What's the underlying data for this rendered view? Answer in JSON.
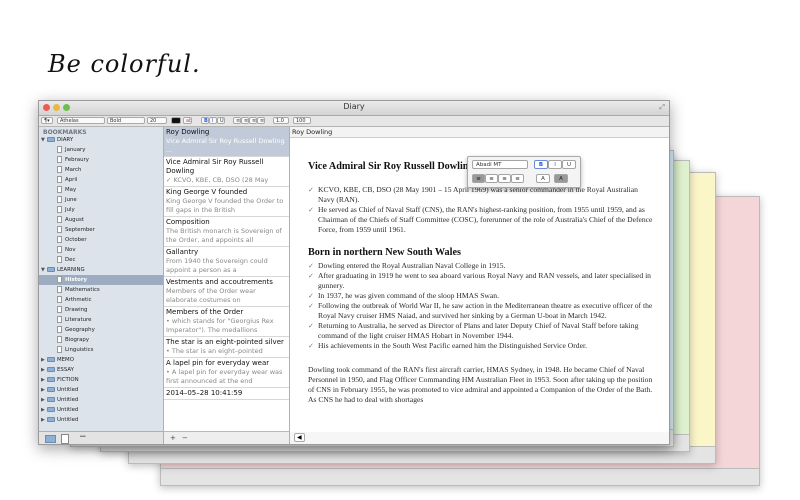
{
  "headline": "Be colorful.",
  "window": {
    "title": "Diary"
  },
  "toolbar": {
    "font": "Athelas",
    "weight": "Bold",
    "size": "20",
    "bold": "B",
    "italic": "I",
    "underline": "U",
    "line_spacing": "1.0",
    "zoom": "100"
  },
  "sidebar": {
    "header": "BOOKMARKS",
    "items": [
      {
        "label": "DIARY",
        "type": "folder",
        "level": 0,
        "expanded": true
      },
      {
        "label": "January",
        "type": "doc",
        "level": 1
      },
      {
        "label": "Febraury",
        "type": "doc",
        "level": 1
      },
      {
        "label": "March",
        "type": "doc",
        "level": 1
      },
      {
        "label": "April",
        "type": "doc",
        "level": 1
      },
      {
        "label": "May",
        "type": "doc",
        "level": 1
      },
      {
        "label": "June",
        "type": "doc",
        "level": 1
      },
      {
        "label": "July",
        "type": "doc",
        "level": 1
      },
      {
        "label": "August",
        "type": "doc",
        "level": 1
      },
      {
        "label": "September",
        "type": "doc",
        "level": 1
      },
      {
        "label": "October",
        "type": "doc",
        "level": 1
      },
      {
        "label": "Nov",
        "type": "doc",
        "level": 1
      },
      {
        "label": "Dec",
        "type": "doc",
        "level": 1
      },
      {
        "label": "LEARNING",
        "type": "folder",
        "level": 0,
        "expanded": true
      },
      {
        "label": "History",
        "type": "doc",
        "level": 1,
        "selected": true
      },
      {
        "label": "Mathematics",
        "type": "doc",
        "level": 1
      },
      {
        "label": "Arthmetic",
        "type": "doc",
        "level": 1
      },
      {
        "label": "Drawing",
        "type": "doc",
        "level": 1
      },
      {
        "label": "Literature",
        "type": "doc",
        "level": 1
      },
      {
        "label": "Geography",
        "type": "doc",
        "level": 1
      },
      {
        "label": "Biograpy",
        "type": "doc",
        "level": 1
      },
      {
        "label": "Linguistics",
        "type": "doc",
        "level": 1
      },
      {
        "label": "MEMO",
        "type": "folder",
        "level": 0
      },
      {
        "label": "ESSAY",
        "type": "folder",
        "level": 0
      },
      {
        "label": "FICTION",
        "type": "folder",
        "level": 0
      },
      {
        "label": "Untitled",
        "type": "folder",
        "level": 0
      },
      {
        "label": "Untitled",
        "type": "folder",
        "level": 0
      },
      {
        "label": "Untitled",
        "type": "folder",
        "level": 0
      },
      {
        "label": "Untitled",
        "type": "folder",
        "level": 0
      }
    ],
    "bottom_minus": "−"
  },
  "notes": [
    {
      "title": "Roy Dowling",
      "snippet": "Vice Admiral Sir Roy Russell Dowling ...",
      "selected": true
    },
    {
      "title": "Vice Admiral Sir Roy Russell Dowling",
      "snippet": "✓ KCVO, KBE, CB, DSO (28 May"
    },
    {
      "title": "King George V founded",
      "snippet": "King George V founded the Order to fill gaps in the British"
    },
    {
      "title": "Composition",
      "snippet": "The British monarch is Sovereign of the Order, and appoints all"
    },
    {
      "title": "Gallantry",
      "snippet": "From 1940 the Sovereign could appoint a person as a"
    },
    {
      "title": "Vestments and accoutrements",
      "snippet": "Members of the Order wear elaborate costumes on"
    },
    {
      "title": "Members of the Order",
      "snippet": "• which stands for \"Georgius Rex Imperator\"). The medallions"
    },
    {
      "title": "The star is an eight-pointed silver",
      "snippet": "• The star is an eight–pointed"
    },
    {
      "title": "A lapel pin for everyday wear",
      "snippet": "• A lapel pin for everyday wear was first announced at the end"
    },
    {
      "title": "2014–05–28 10:41:59",
      "snippet": ""
    }
  ],
  "notes_bottom": {
    "plus": "+",
    "minus": "−"
  },
  "editor": {
    "header": "Roy Dowling",
    "heading1": "Vice Admiral Sir Roy Russell Dowling",
    "bullets1": [
      "KCVO, KBE, CB, DSO (28 May 1901 – 15 April 1969) was a senior commander in the Royal Australian Navy (RAN).",
      "He served as Chief of Naval Staff (CNS), the RAN's highest-ranking position, from 1955 until 1959, and as Chairman of the Chiefs of Staff Committee (COSC), forerunner of the role of Australia's Chief of the Defence Force, from 1959 until 1961."
    ],
    "heading2": "Born in northern New South Wales",
    "bullets2": [
      "Dowling entered the Royal Australian Naval College in 1915.",
      "After graduating in 1919 he went to sea aboard various Royal Navy and RAN vessels, and later specialised in gunnery.",
      "In 1937, he was given command of the sloop HMAS Swan.",
      "Following the outbreak of World War II, he saw action in the Mediterranean theatre as executive officer of the Royal Navy cruiser HMS Naiad, and survived her sinking by a German U-boat in March 1942.",
      "Returning to Australia, he served as Director of Plans and later Deputy Chief of Naval Staff before taking command of the light cruiser HMAS Hobart in November 1944.",
      "His achievements in the South West Pacific earned him the Distinguished Service Order."
    ],
    "para": "Dowling took command of the RAN's first aircraft carrier, HMAS Sydney, in 1948. He became Chief of Naval Personnel in 1950, and Flag Officer Commanding HM Australian Fleet in 1953. Soon after taking up the position of CNS in February 1955, he was promoted to vice admiral and appointed a Companion of the Order of the Bath. As CNS he had to deal with shortages",
    "check": "✓",
    "back_arrow": "◀"
  },
  "format_popup": {
    "font": "Abadi MT",
    "bold": "B",
    "italic": "I",
    "underline": "U",
    "text_a": "A",
    "text_a_highlight": "A"
  },
  "colors": {
    "window_pink": "#f5d6d8",
    "window_yellow": "#fbf6c8",
    "window_green": "#dff2cf",
    "window_blue": "#d8ecf8",
    "sidebar_bg": "#dde3ea",
    "selection": "#9dacc0"
  }
}
